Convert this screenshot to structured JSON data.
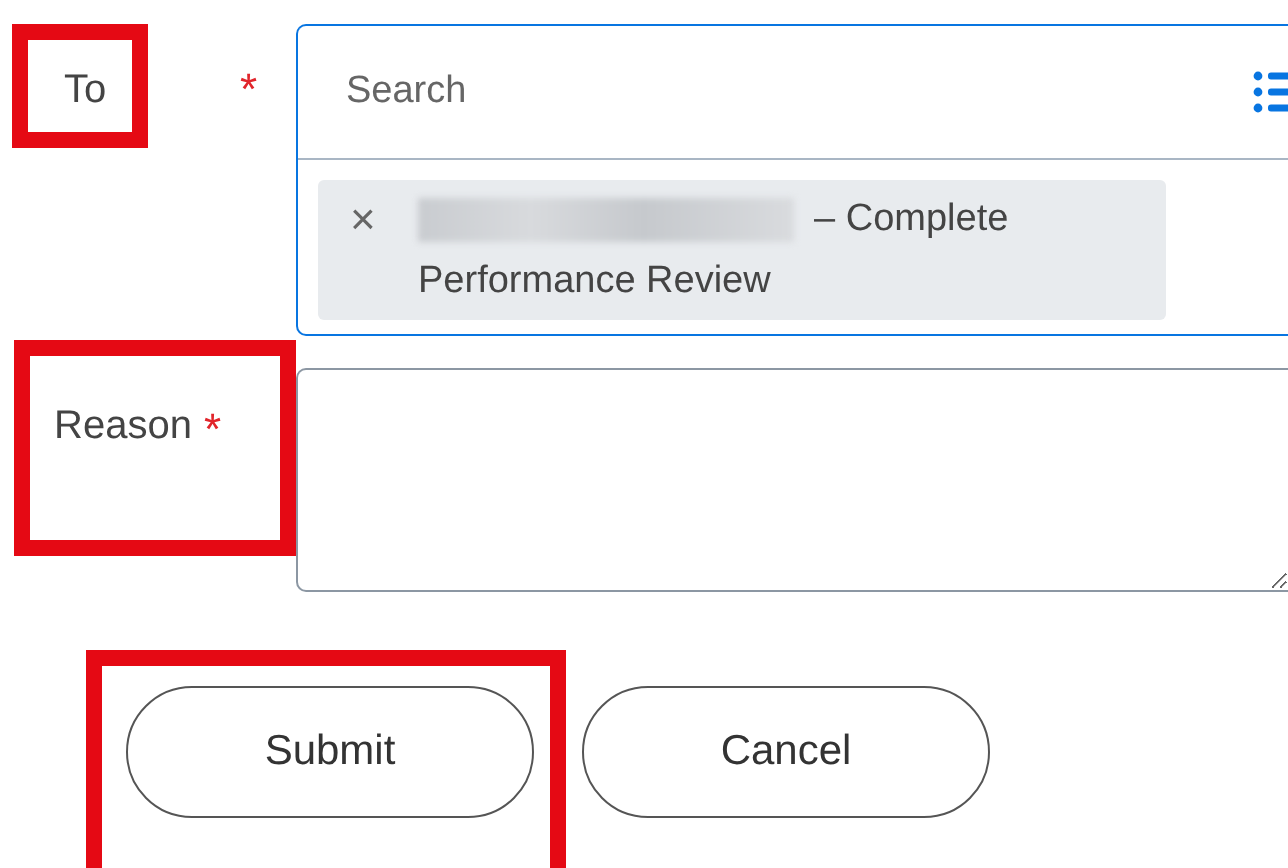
{
  "to_field": {
    "label": "To",
    "required_mark": "*",
    "highlighted": true,
    "search": {
      "placeholder": "Search"
    },
    "selected_items": [
      {
        "remove_glyph": "×",
        "text_lines": [
          "– Complete",
          "Performance Review"
        ],
        "name_redacted": true
      }
    ]
  },
  "reason_field": {
    "label": "Reason",
    "required_mark": "*",
    "highlighted": true
  },
  "buttons": [
    {
      "label": "Submit",
      "highlighted": true
    },
    {
      "label": "Cancel",
      "highlighted": false
    }
  ]
}
